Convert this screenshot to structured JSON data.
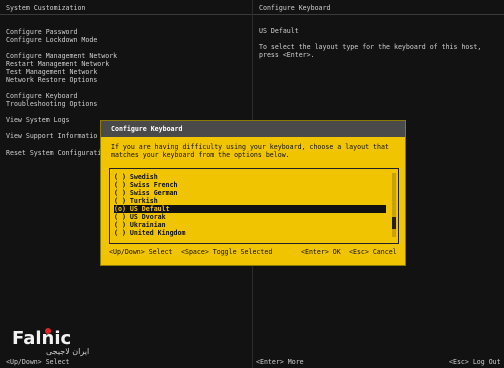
{
  "header": {
    "left_title": "System Customization",
    "right_title": "Configure Keyboard"
  },
  "menu": {
    "items": [
      "Configure Password",
      "Configure Lockdown Mode",
      "Configure Management Network",
      "Restart Management Network",
      "Test Management Network",
      "Network Restore Options",
      "Configure Keyboard",
      "Troubleshooting Options",
      "View System Logs",
      "View Support Informatio",
      "Reset System Configurati"
    ]
  },
  "right_panel": {
    "current": "US Default",
    "description": "To select the layout type for the keyboard of this host, press <Enter>."
  },
  "dialog": {
    "title": "Configure Keyboard",
    "text": "If you are having difficulty using your keyboard, choose a layout that matches your keyboard from the options below.",
    "options": [
      "( ) Swedish",
      "( ) Swiss French",
      "( ) Swiss German",
      "( ) Turkish",
      "(o) US Default",
      "( ) US Dvorak",
      "( ) Ukrainian",
      "( ) United Kingdom"
    ],
    "selected_index": 4,
    "footer_select": "<Up/Down> Select",
    "footer_toggle": "<Space> Toggle Selected",
    "footer_ok": "<Enter> OK",
    "footer_cancel": "<Esc> Cancel"
  },
  "logo": {
    "name": "Falnic",
    "sub": "ایران لاجیجی"
  },
  "footer": {
    "left": "<Up/Down> Select",
    "center": "<Enter> More",
    "right": "<Esc> Log Out"
  }
}
